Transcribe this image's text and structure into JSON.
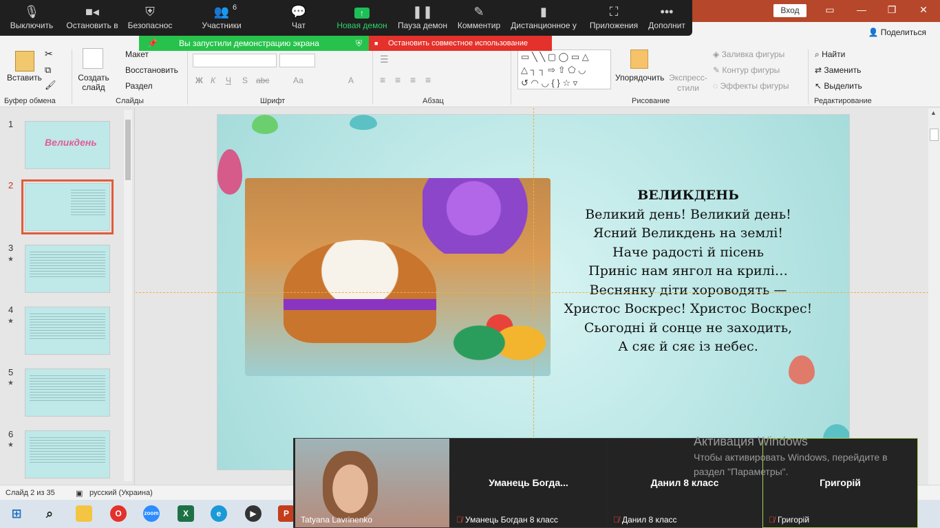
{
  "window": {
    "sign_in": "Вход",
    "share": "Поделиться"
  },
  "zoom_toolbar": {
    "items": [
      {
        "label": "Выключить",
        "icon": "microphone-icon"
      },
      {
        "label": "Остановить в",
        "icon": "video-camera-icon"
      },
      {
        "label": "Безопаснос",
        "icon": "shield-icon"
      },
      {
        "label": "Участники",
        "icon": "participants-icon",
        "count": "6"
      },
      {
        "label": "Чат",
        "icon": "chat-icon"
      },
      {
        "label": "Новая демон",
        "icon": "share-screen-icon"
      },
      {
        "label": "Пауза демон",
        "icon": "pause-icon"
      },
      {
        "label": "Комментир",
        "icon": "pencil-icon"
      },
      {
        "label": "Дистанционное у",
        "icon": "mouse-icon"
      },
      {
        "label": "Приложения",
        "icon": "apps-icon"
      },
      {
        "label": "Дополнит",
        "icon": "more-icon"
      }
    ],
    "sharing_status": "Вы запустили демонстрацию экрана",
    "stop_sharing": "Остановить совместное использование"
  },
  "ribbon": {
    "clipboard": {
      "paste": "Вставить",
      "label": "Буфер обмена"
    },
    "slides": {
      "new_slide": "Создать слайд",
      "layout": "Макет",
      "reset": "Восстановить",
      "section": "Раздел",
      "label": "Слайды"
    },
    "font": {
      "label": "Шрифт",
      "bold": "Ж",
      "italic": "К",
      "underline": "Ч",
      "shadow": "S",
      "strike": "abc",
      "case": "Аа",
      "color": "A"
    },
    "paragraph": {
      "label": "Абзац"
    },
    "drawing": {
      "arrange": "Упорядочить",
      "quick_styles": "Экспресс-стили",
      "fill": "Заливка фигуры",
      "outline": "Контур фигуры",
      "effects": "Эффекты фигуры",
      "label": "Рисование"
    },
    "editing": {
      "find": "Найти",
      "replace": "Заменить",
      "select": "Выделить",
      "label": "Редактирование"
    }
  },
  "thumbnails": [
    {
      "num": "1",
      "star": false,
      "title": "Великдень"
    },
    {
      "num": "2",
      "star": false,
      "selected": true
    },
    {
      "num": "3",
      "star": true
    },
    {
      "num": "4",
      "star": true
    },
    {
      "num": "5",
      "star": true
    },
    {
      "num": "6",
      "star": true
    }
  ],
  "slide": {
    "title": "ВЕЛИКДЕНЬ",
    "lines": [
      "Великий день! Великий день!",
      "Ясний Великдень на землі!",
      "Наче радості й пісень",
      "Приніс нам янгол на крилі…",
      "Веснянку діти хороводять —",
      "Христос Воскрес! Христос Воскрес!",
      "Сьогодні й сонце не заходить,",
      "А сяє й сяє із небес."
    ]
  },
  "status": {
    "slide_counter": "Слайд 2 из 35",
    "language": "русский (Украина)"
  },
  "video": [
    {
      "display": "",
      "footer": "Tatyana Lavrinenko",
      "muted": false
    },
    {
      "display": "Уманець  Богда...",
      "footer": "Уманець Богдан 8 класс",
      "muted": true
    },
    {
      "display": "Данил 8 класс",
      "footer": "Данил 8 класс",
      "muted": true
    },
    {
      "display": "Григорій",
      "footer": "Григорій",
      "muted": true
    }
  ],
  "activation": {
    "title": "Активация Windows",
    "body": "Чтобы активировать Windows, перейдите в раздел \"Параметры\"."
  },
  "taskbar": [
    "windows-icon",
    "search-icon",
    "file-explorer-icon",
    "opera-icon",
    "zoom-icon",
    "excel-icon",
    "edge-icon",
    "media-player-icon",
    "powerpoint-icon"
  ]
}
